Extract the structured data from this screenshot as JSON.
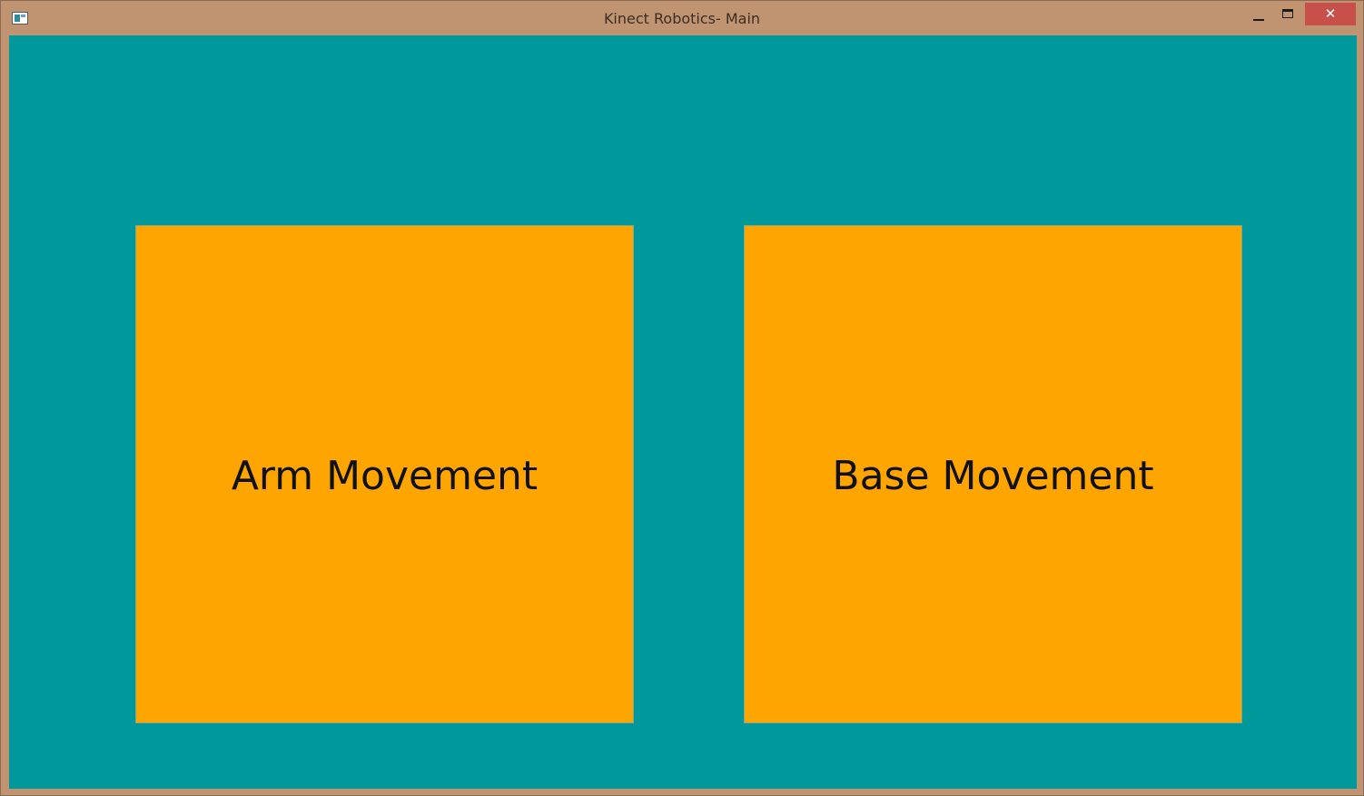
{
  "window": {
    "title": "Kinect Robotics- Main",
    "controls": {
      "minimize_icon": "minimize-icon",
      "maximize_icon": "maximize-icon",
      "close_icon": "close-icon",
      "close_glyph": "✕"
    }
  },
  "colors": {
    "frame": "#c09471",
    "background": "#00989a",
    "tile": "#ffa500",
    "close_button": "#c7504a"
  },
  "main": {
    "tiles": [
      {
        "label": "Arm Movement"
      },
      {
        "label": "Base Movement"
      }
    ]
  }
}
